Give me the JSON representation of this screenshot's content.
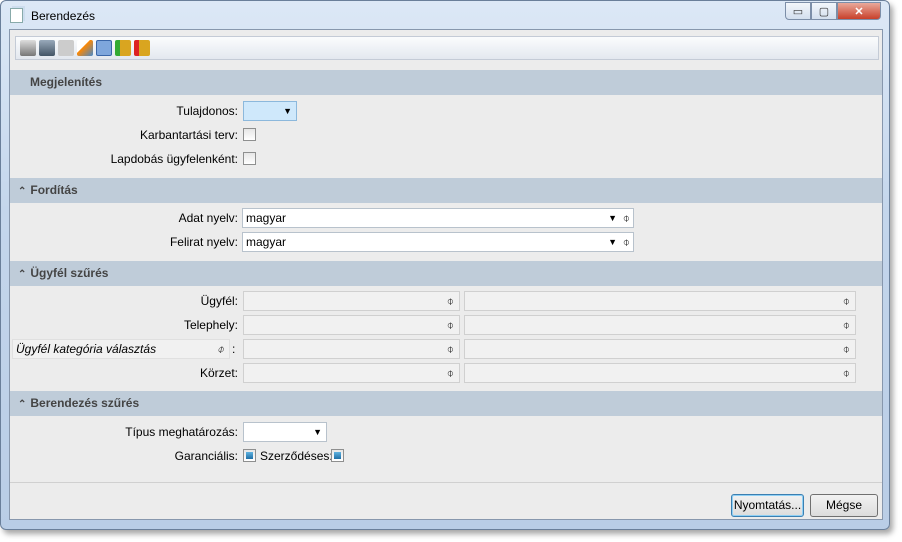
{
  "window": {
    "title": "Berendezés",
    "minimize": "▭",
    "maximize": "▢",
    "close": "✕"
  },
  "toolbar": {
    "icons": [
      "printer-icon",
      "print-setup-icon",
      "preview-icon",
      "edit-icon",
      "calculator-icon",
      "database-refresh-icon",
      "database-export-icon"
    ]
  },
  "sections": {
    "display": {
      "title": "Megjelenítés",
      "owner_label": "Tulajdonos:",
      "owner_value": "",
      "maint_label": "Karbantartási terv:",
      "maint_checked": false,
      "page_label": "Lapdobás ügyfelenként:",
      "page_checked": false
    },
    "translation": {
      "title": "Fordítás",
      "data_lang_label": "Adat nyelv:",
      "data_lang_value": "magyar",
      "caption_lang_label": "Felirat nyelv:",
      "caption_lang_value": "magyar"
    },
    "client_filter": {
      "title": "Ügyfél szűrés",
      "client_label": "Ügyfél:",
      "site_label": "Telephely:",
      "category_label": "Ügyfél kategória választás",
      "category_colon": ":",
      "district_label": "Körzet:"
    },
    "equipment_filter": {
      "title": "Berendezés szűrés",
      "type_label": "Típus meghatározás:",
      "type_value": "",
      "warranty_label": "Garanciális:",
      "warranty_checked": true,
      "contract_label": "Szerződéses:",
      "contract_checked": true
    }
  },
  "buttons": {
    "print": "Nyomtatás...",
    "cancel": "Mégse"
  },
  "colors": {
    "section_bg": "#bfccd9",
    "owner_field": "#cfe8fb"
  }
}
